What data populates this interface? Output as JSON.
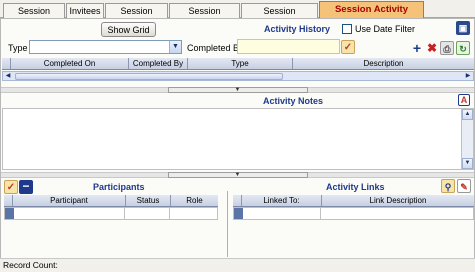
{
  "tabs": [
    {
      "label": "Session Details"
    },
    {
      "label": "Invitees"
    },
    {
      "label": "Session Vendors"
    },
    {
      "label": "Session Expenses"
    },
    {
      "label": "Session Documents"
    },
    {
      "label": "Session Activity History",
      "active": true
    }
  ],
  "toolbar": {
    "show_grid_label": "Show Grid",
    "section_title": "Activity History",
    "use_date_filter_label": "Use Date Filter",
    "use_date_filter_checked": false,
    "type_label": "Type",
    "type_value": "",
    "completed_by_label": "Completed By",
    "completed_by_value": ""
  },
  "activity_grid": {
    "columns": [
      "Completed On",
      "Completed By",
      "Type",
      "Description"
    ]
  },
  "notes": {
    "title": "Activity Notes"
  },
  "participants": {
    "title": "Participants",
    "columns": [
      "Participant",
      "Status",
      "Role"
    ]
  },
  "links": {
    "title": "Activity Links",
    "columns": [
      "Linked To:",
      "Link Description"
    ]
  },
  "status": {
    "record_count_label": "Record Count:",
    "record_count_value": ""
  },
  "colors": {
    "accent_tab": "#f5c27a",
    "title_blue": "#1f3a8a",
    "grid_header": "#c7cfe0"
  }
}
